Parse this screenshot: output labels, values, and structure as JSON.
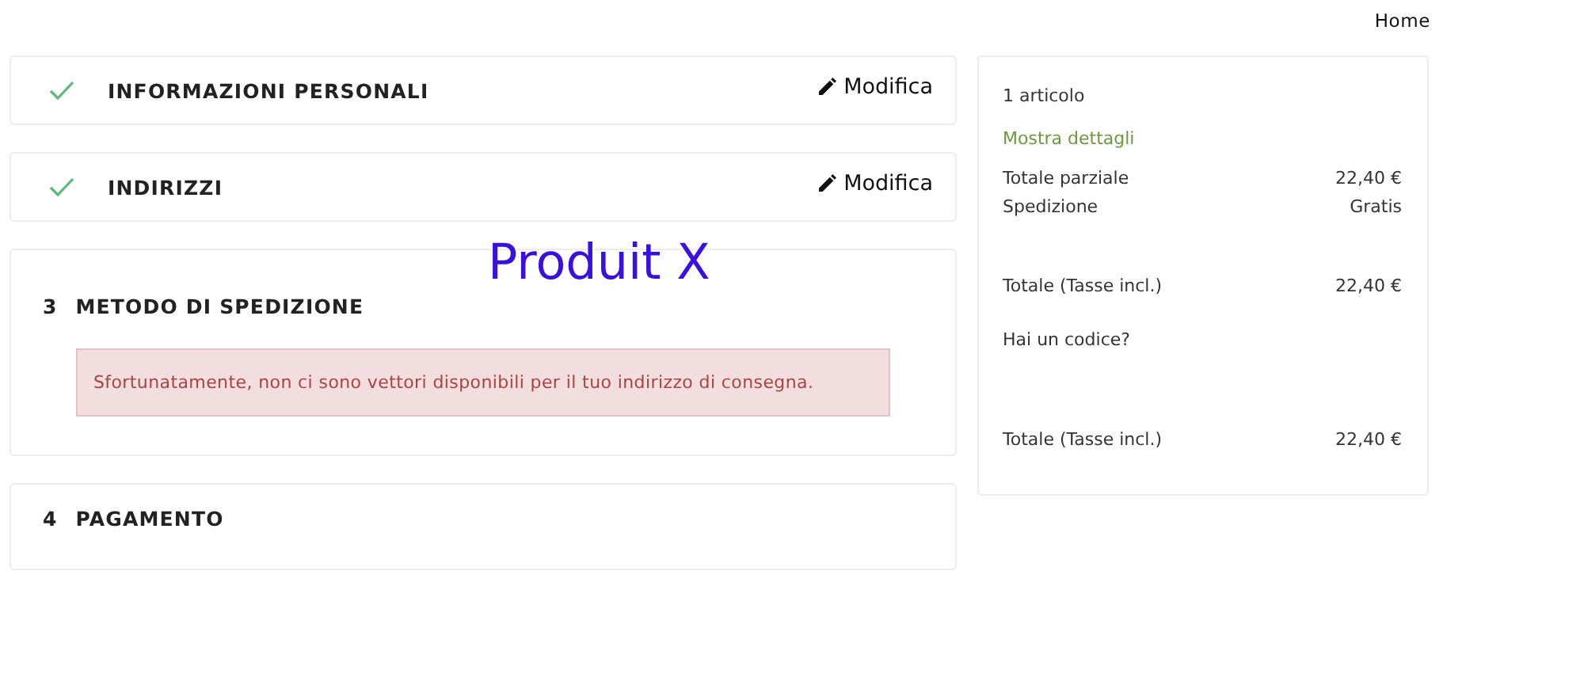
{
  "top_nav": {
    "home_link": "Home"
  },
  "steps": [
    {
      "kind": "done",
      "title": "INFORMAZIONI PERSONALI",
      "edit_label": "Modifica"
    },
    {
      "kind": "done",
      "title": "INDIRIZZI",
      "edit_label": "Modifica"
    },
    {
      "kind": "current",
      "number": "3",
      "title": "METODO DI SPEDIZIONE",
      "alert": "Sfortunatamente, non ci sono vettori disponibili per il tuo indirizzo di consegna."
    },
    {
      "kind": "pending",
      "number": "4",
      "title": "PAGAMENTO"
    }
  ],
  "annotation": "Produit X",
  "summary": {
    "items_count": "1 articolo",
    "details_link": "Mostra dettagli",
    "lines": [
      {
        "label": "Totale parziale",
        "value": "22,40 €"
      },
      {
        "label": "Spedizione",
        "value": "Gratis"
      }
    ],
    "total": {
      "label": "Totale (Tasse incl.)",
      "value": "22,40 €"
    },
    "promo_link": "Hai un codice?",
    "final_total": {
      "label": "Totale (Tasse incl.)",
      "value": "22,40 €"
    }
  }
}
